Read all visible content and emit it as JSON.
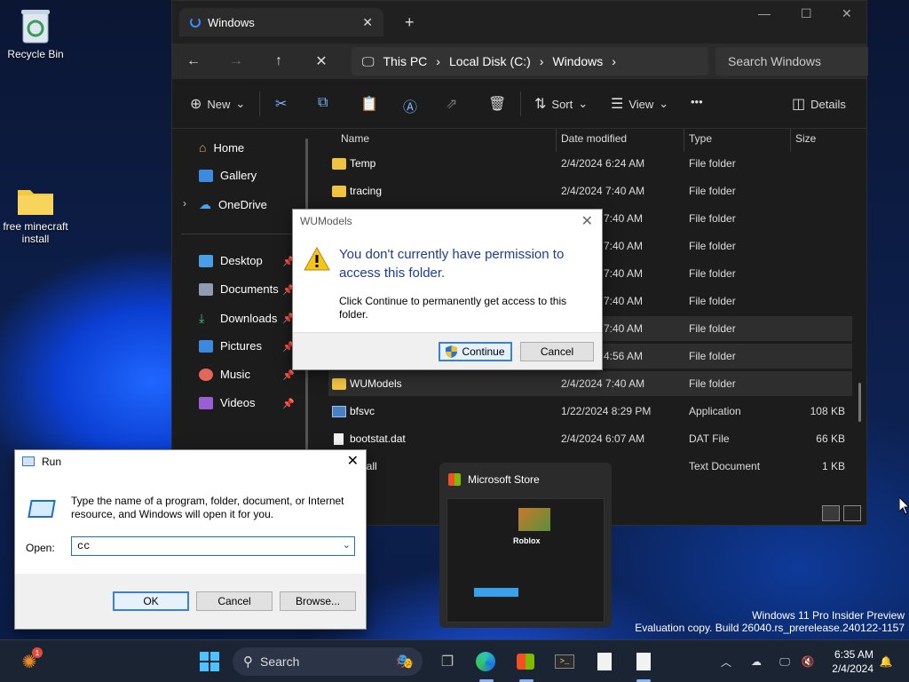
{
  "desktop": {
    "icons": [
      {
        "label": "Recycle Bin"
      },
      {
        "label": "free minecraft install"
      }
    ],
    "watermark": {
      "line1": "Windows 11 Pro Insider Preview",
      "line2": "Evaluation copy. Build 26040.rs_prerelease.240122-1157"
    }
  },
  "explorer": {
    "tab_title": "Windows",
    "address": {
      "crumbs": [
        "This PC",
        "Local Disk (C:)",
        "Windows"
      ]
    },
    "search_placeholder": "Search Windows",
    "toolbar": {
      "new_label": "New",
      "sort_label": "Sort",
      "view_label": "View",
      "details_label": "Details",
      "more_label": "•••"
    },
    "sidebar": {
      "top": [
        {
          "label": "Home"
        },
        {
          "label": "Gallery"
        },
        {
          "label": "OneDrive"
        }
      ],
      "pinned": [
        {
          "label": "Desktop"
        },
        {
          "label": "Documents"
        },
        {
          "label": "Downloads"
        },
        {
          "label": "Pictures"
        },
        {
          "label": "Music"
        },
        {
          "label": "Videos"
        }
      ]
    },
    "columns": {
      "name": "Name",
      "date": "Date modified",
      "type": "Type",
      "size": "Size"
    },
    "rows": [
      {
        "name": "Temp",
        "date": "2/4/2024 6:24 AM",
        "type": "File folder",
        "size": "",
        "kind": "folder"
      },
      {
        "name": "tracing",
        "date": "2/4/2024 7:40 AM",
        "type": "File folder",
        "size": "",
        "kind": "folder"
      },
      {
        "name": "",
        "date": "7:40 AM",
        "type": "File folder",
        "size": "",
        "kind": "hidden"
      },
      {
        "name": "",
        "date": "7:40 AM",
        "type": "File folder",
        "size": "",
        "kind": "hidden"
      },
      {
        "name": "",
        "date": "7:40 AM",
        "type": "File folder",
        "size": "",
        "kind": "hidden"
      },
      {
        "name": "",
        "date": "7:40 AM",
        "type": "File folder",
        "size": "",
        "kind": "hidden"
      },
      {
        "name": "",
        "date": "7:40 AM",
        "type": "File folder",
        "size": "",
        "kind": "hidden"
      },
      {
        "name": "",
        "date": "4:56 AM",
        "type": "File folder",
        "size": "",
        "kind": "hidden"
      },
      {
        "name": "WUModels",
        "date": "2/4/2024 7:40 AM",
        "type": "File folder",
        "size": "",
        "kind": "folder"
      },
      {
        "name": "bfsvc",
        "date": "1/22/2024 8:29 PM",
        "type": "Application",
        "size": "108 KB",
        "kind": "app"
      },
      {
        "name": "bootstat.dat",
        "date": "2/4/2024 6:07 AM",
        "type": "DAT File",
        "size": "66 KB",
        "kind": "doc"
      },
      {
        "name": "install",
        "date": "",
        "type": "Text Document",
        "size": "1 KB",
        "kind": "doc"
      }
    ]
  },
  "permission_dialog": {
    "title": "WUModels",
    "main_text": "You don't currently have permission to access this folder.",
    "sub_text": "Click Continue to permanently get access to this folder.",
    "continue_label": "Continue",
    "cancel_label": "Cancel"
  },
  "run_dialog": {
    "title": "Run",
    "description": "Type the name of a program, folder, document, or Internet resource, and Windows will open it for you.",
    "open_label": "Open:",
    "input_value": "cc",
    "ok_label": "OK",
    "cancel_label": "Cancel",
    "browse_label": "Browse..."
  },
  "store_preview": {
    "title": "Microsoft Store",
    "app_name": "Roblox"
  },
  "taskbar": {
    "search_label": "Search",
    "time": "6:35 AM",
    "date": "2/4/2024",
    "badge_count": "1"
  }
}
